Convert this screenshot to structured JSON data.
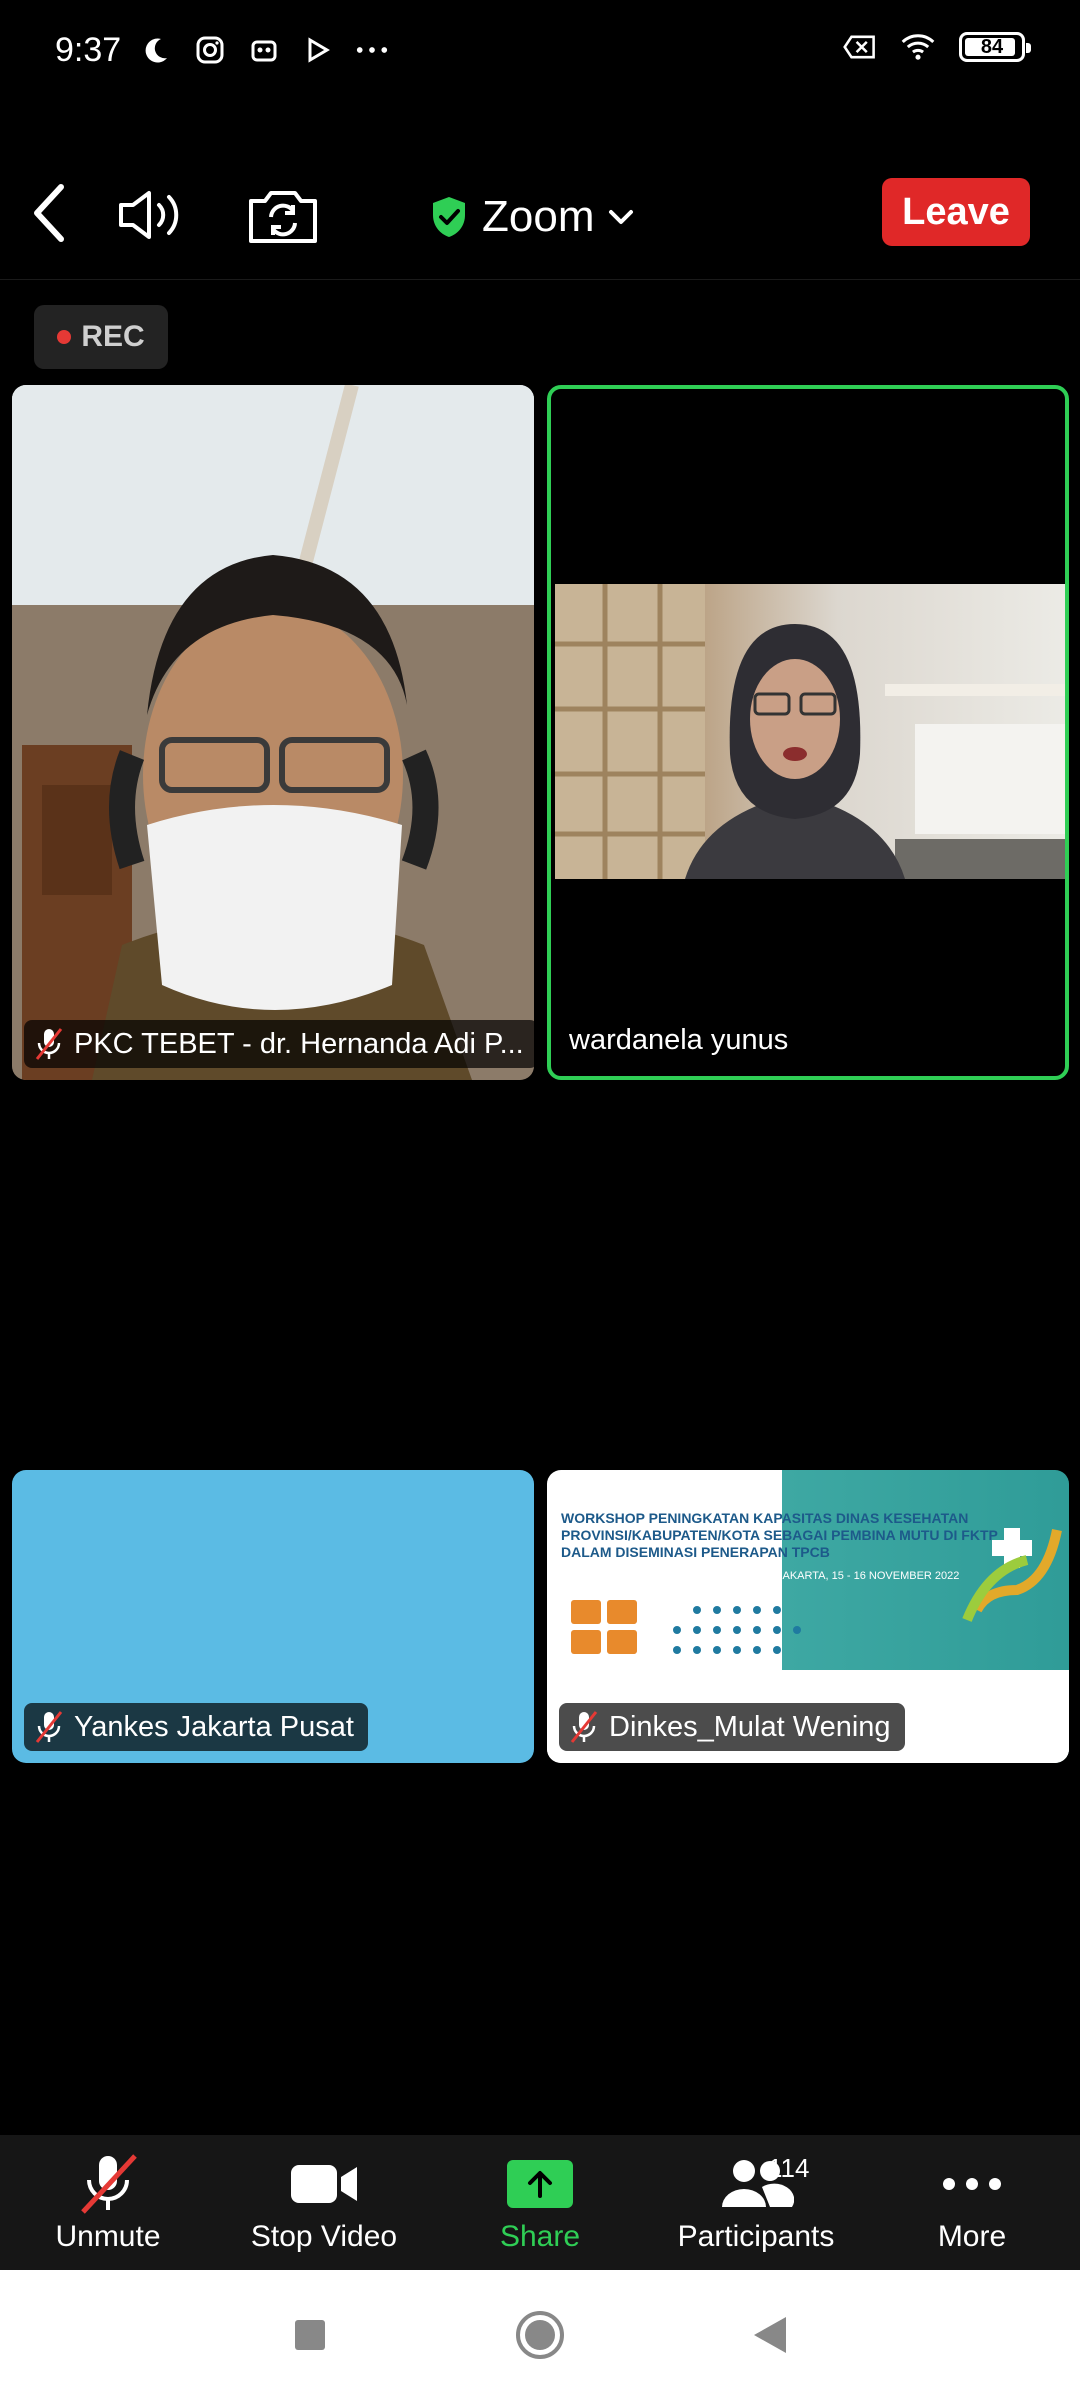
{
  "status_bar": {
    "time": "9:37",
    "battery": "84"
  },
  "top_bar": {
    "meeting_title": "Zoom",
    "leave_label": "Leave"
  },
  "recording": {
    "label": "REC"
  },
  "participants_tiles": [
    {
      "name": "PKC TEBET - dr. Hernanda Adi P...",
      "muted": true,
      "active_speaker": false
    },
    {
      "name": "wardanela yunus",
      "muted": false,
      "active_speaker": true
    },
    {
      "name": "Yankes Jakarta Pusat",
      "muted": true,
      "active_speaker": false
    },
    {
      "name": "Dinkes_Mulat Wening",
      "muted": true,
      "active_speaker": false
    }
  ],
  "shared_slide": {
    "text": "WORKSHOP PENINGKATAN KAPASITAS DINAS KESEHATAN PROVINSI/KABUPATEN/KOTA SEBAGAI PEMBINA MUTU DI FKTP DALAM DISEMINASI PENERAPAN TPCB",
    "sub": "JAKARTA, 15 - 16 NOVEMBER 2022"
  },
  "bottom_bar": {
    "unmute_label": "Unmute",
    "stop_video_label": "Stop Video",
    "share_label": "Share",
    "participants_label": "Participants",
    "participants_count": "114",
    "more_label": "More"
  },
  "colors": {
    "accent_green": "#2fce55",
    "leave_red": "#e02828",
    "rec_red": "#e53935",
    "tile_blue": "#5bbbe4"
  },
  "icons": {
    "back": "chevron-left-icon",
    "speaker": "speaker-icon",
    "camera_switch": "camera-switch-icon",
    "shield": "shield-check-icon",
    "mic_off": "mic-off-icon",
    "video": "video-camera-icon",
    "share": "share-arrow-icon",
    "participants": "people-icon",
    "more": "more-dots-icon"
  }
}
